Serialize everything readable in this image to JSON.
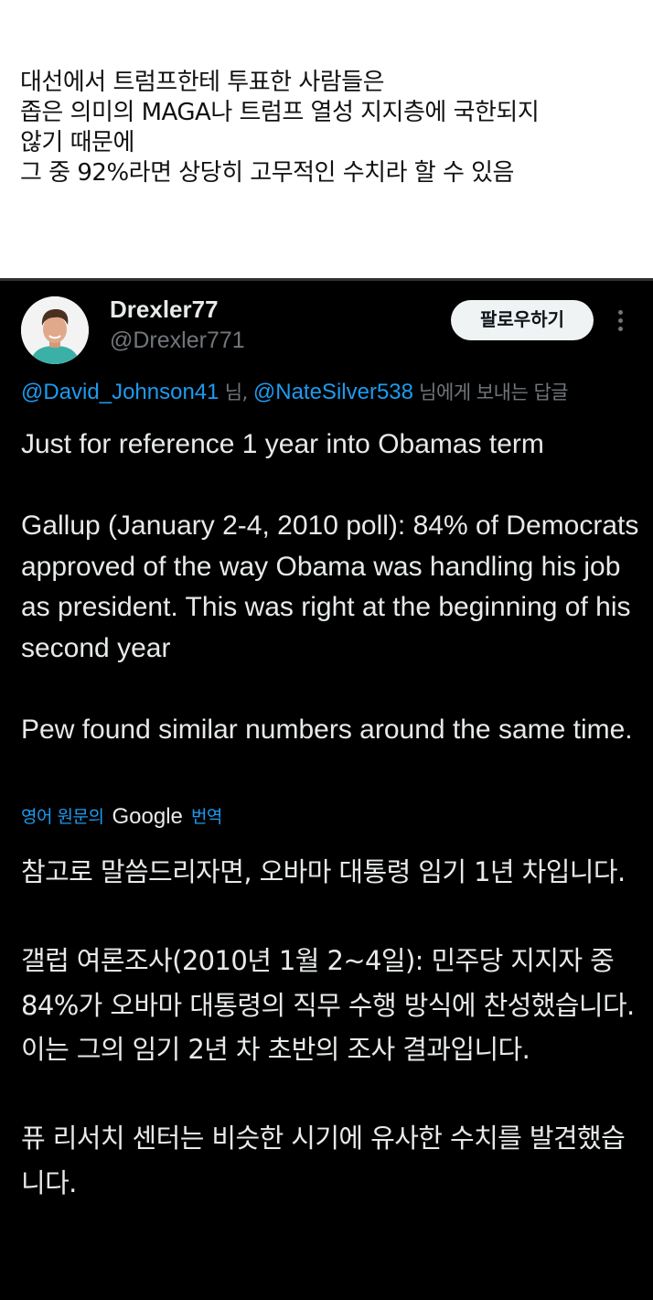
{
  "caption": {
    "lines": [
      "대선에서 트럼프한테 투표한 사람들은",
      "좁은 의미의 MAGA나 트럼프 열성 지지층에 국한되지",
      "않기 때문에",
      "그 중 92%라면 상당히 고무적인 수치라 할 수 있음"
    ]
  },
  "tweet": {
    "display_name": "Drexler77",
    "handle": "@Drexler771",
    "follow_label": "팔로우하기",
    "more_icon": "more-vertical-icon",
    "avatar_icon": "profile-photo",
    "reply_to": {
      "mention_1": "@David_Johnson41",
      "separator": " 님, ",
      "mention_2": "@NateSilver538",
      "suffix": " 님에게 보내는 답글"
    },
    "body": {
      "p1": "Just for reference 1 year into Obamas term",
      "p2": "Gallup (January 2-4, 2010 poll): 84% of Democrats approved of the way Obama was handling his job as president. This was right at the beginning of his second year",
      "p3": "Pew found similar numbers around the same time."
    },
    "translation": {
      "label_before": "영어 원문의",
      "google": "Google",
      "label_after": "번역",
      "p1": "참고로 말씀드리자면, 오바마 대통령 임기 1년 차입니다.",
      "p2": "갤럽 여론조사(2010년 1월 2~4일): 민주당 지지자 중 84%가 오바마 대통령의 직무 수행 방식에 찬성했습니다. 이는 그의 임기 2년 차 초반의 조사 결과입니다.",
      "p3": "퓨 리서치 센터는 비슷한 시기에 유사한 수치를 발견했습니다."
    },
    "colors": {
      "background": "#000000",
      "text": "#e7e9ea",
      "secondary": "#71767b",
      "link": "#1d9bf0",
      "button_bg": "#eff3f4"
    }
  }
}
